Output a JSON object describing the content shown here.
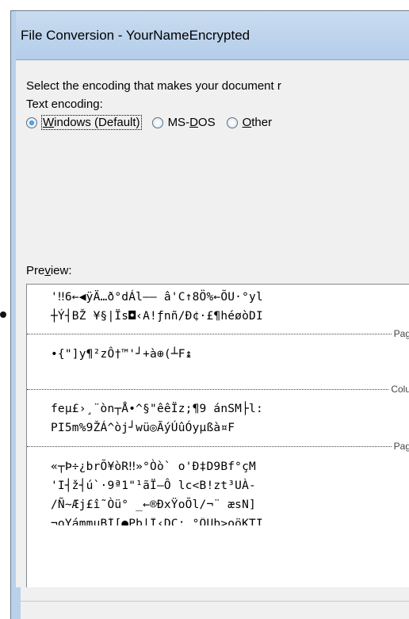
{
  "window": {
    "title": "File Conversion - YourNameEncrypted"
  },
  "dialog": {
    "instruction": "Select the encoding that makes your document r",
    "text_encoding_label": "Text encoding:",
    "encodings": [
      {
        "label_pre": "",
        "label_u": "W",
        "label_post": "indows (Default)",
        "checked": true
      },
      {
        "label_pre": "MS-",
        "label_u": "D",
        "label_post": "OS",
        "checked": false
      },
      {
        "label_pre": "",
        "label_u": "O",
        "label_post": "ther",
        "checked": false
      }
    ],
    "preview_label_pre": "Pre",
    "preview_label_u": "v",
    "preview_label_post": "iew:"
  },
  "preview": {
    "lines": [
      "'‼6←◀ÿÄ…ð°dÁl—— â'C↑8Ö%←ÕU·°yl",
      "┼Ý┤BŽ ¥§|Ïs◘‹A!ƒnñ/Ð¢·£¶héøòDI",
      "•{\"]y¶²zÔ†™'┘+à⊕(┴F↨",
      "feμ£›¸¨òn┬Å•^§\"êêÏz;¶9 ánSM├l:",
      "PI5m%9ŽÁ^òj┘wü◎ÃýÚûÓyμßà¤F",
      "«┬Þ÷¿brÕ¥òR‼»°Òò` o'Ð‡D9Bf°çM",
      "'I┤ž┤ú`·9ª1\"¹ãÏ—Ô lc<B!zt³UÀ-",
      "/Ñ~Æj£î˜Òü° _←®ÐxŸoÕl/¬¨ æsN]",
      "¬oYámmuBÍ[●Pb|Î‹DC: °ÔUb>oöKTI"
    ],
    "breaks": {
      "page1": "Pag",
      "column": "Colu",
      "page2": "Pag"
    }
  }
}
